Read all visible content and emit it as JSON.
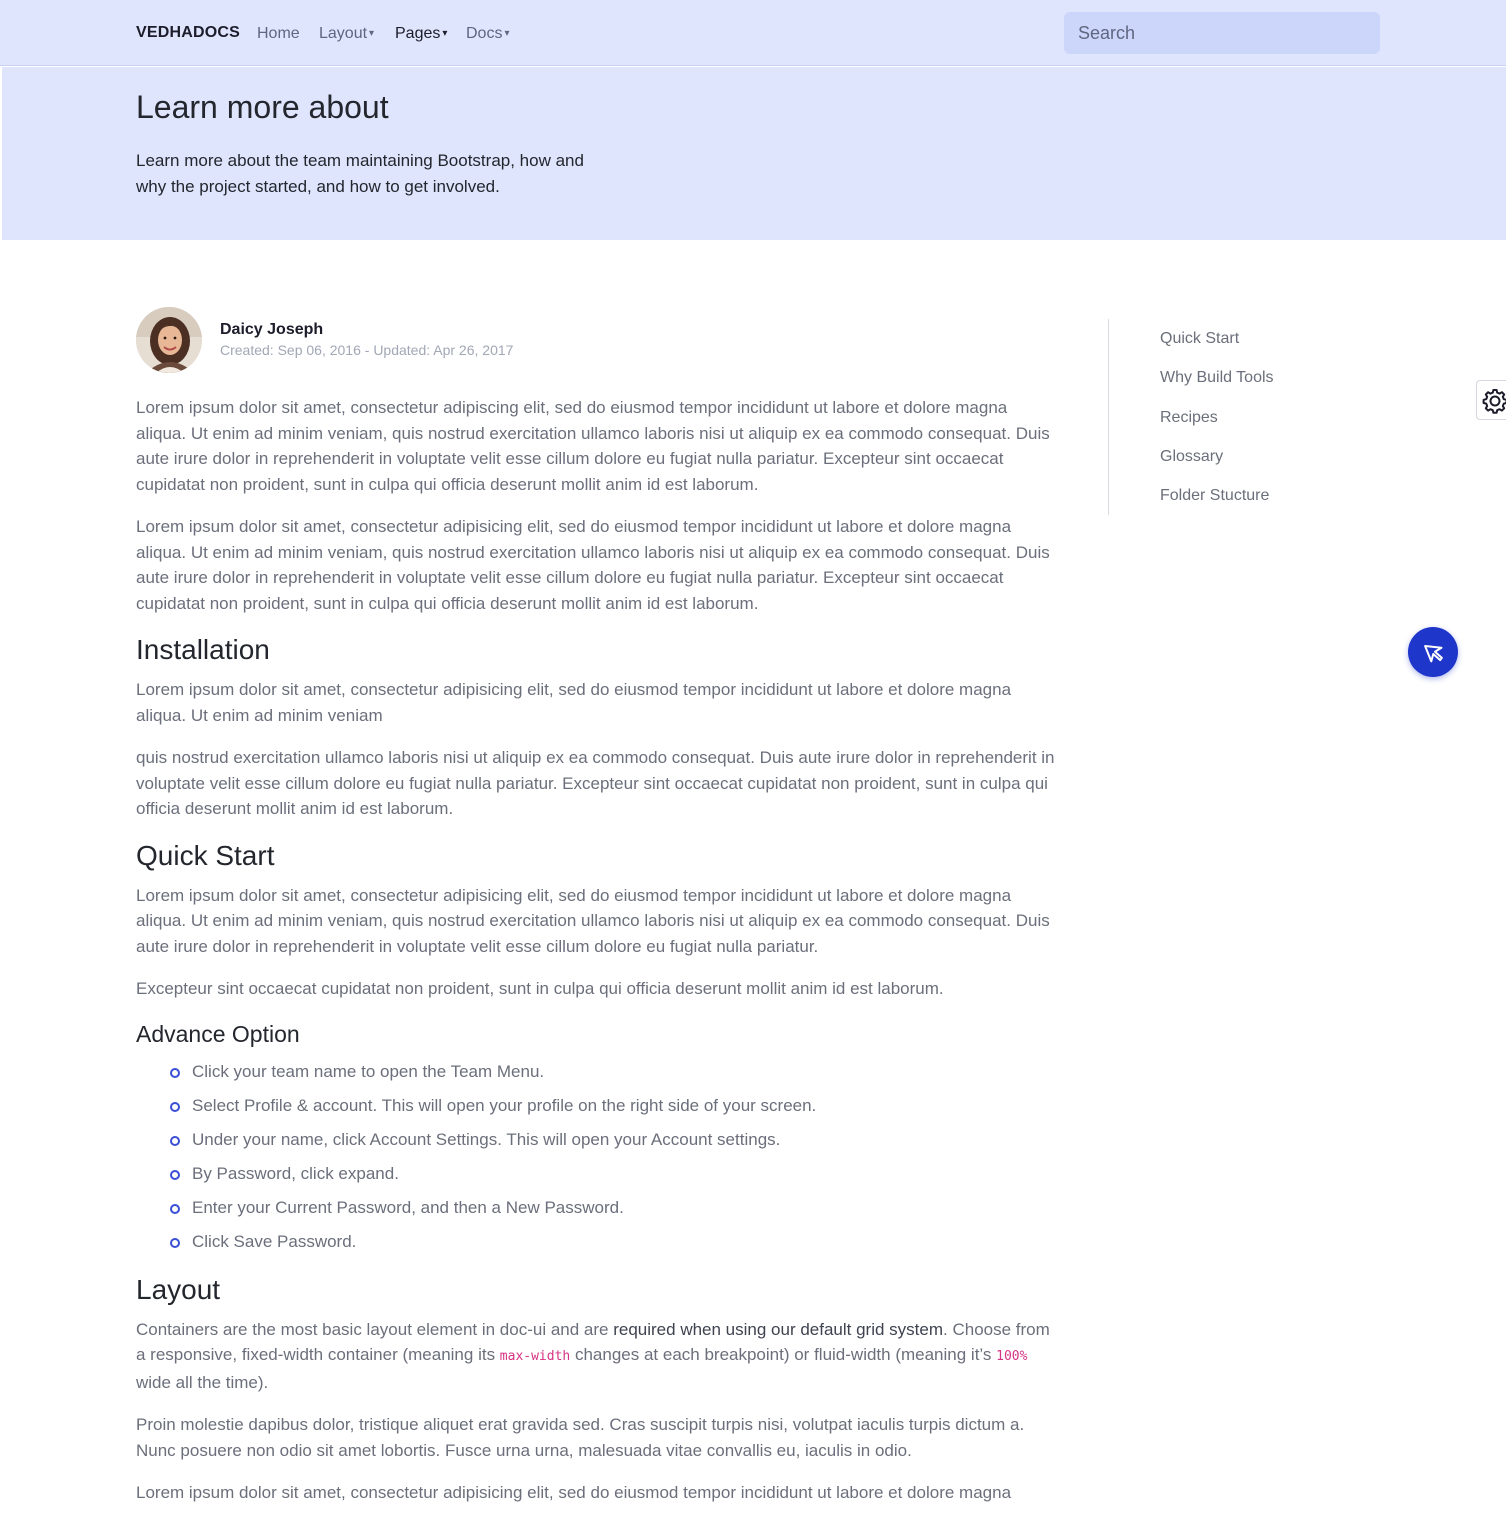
{
  "navbar": {
    "brand": "VEDHADOCS",
    "items": [
      {
        "label": "Home",
        "caret": ""
      },
      {
        "label": "Layout",
        "caret": "▾"
      },
      {
        "label": "Pages",
        "caret": "▾"
      },
      {
        "label": "Docs",
        "caret": "▾"
      }
    ],
    "search_placeholder": "Search"
  },
  "hero": {
    "title": "Learn more about",
    "text": "Learn more about the team maintaining Bootstrap, how and why the project started, and how to get involved."
  },
  "author": {
    "name": "Daicy Joseph",
    "meta": "Created: Sep 06, 2016 - Updated: Apr 26, 2017"
  },
  "content": {
    "intro_1": "Lorem ipsum dolor sit amet, consectetur adipiscing elit, sed do eiusmod tempor incididunt ut labore et dolore magna aliqua. Ut enim ad minim veniam, quis nostrud exercitation ullamco laboris nisi ut aliquip ex ea commodo consequat. Duis aute irure dolor in reprehenderit in voluptate velit esse cillum dolore eu fugiat nulla pariatur. Excepteur sint occaecat cupidatat non proident, sunt in culpa qui officia deserunt mollit anim id est laborum.",
    "intro_2": "Lorem ipsum dolor sit amet, consectetur adipisicing elit, sed do eiusmod tempor incididunt ut labore et dolore magna aliqua. Ut enim ad minim veniam, quis nostrud exercitation ullamco laboris nisi ut aliquip ex ea commodo consequat. Duis aute irure dolor in reprehenderit in voluptate velit esse cillum dolore eu fugiat nulla pariatur. Excepteur sint occaecat cupidatat non proident, sunt in culpa qui officia deserunt mollit anim id est laborum.",
    "installation": {
      "heading": "Installation",
      "p1": "Lorem ipsum dolor sit amet, consectetur adipisicing elit, sed do eiusmod tempor incididunt ut labore et dolore magna aliqua. Ut enim ad minim veniam",
      "p2": "quis nostrud exercitation ullamco laboris nisi ut aliquip ex ea commodo consequat. Duis aute irure dolor in reprehenderit in voluptate velit esse cillum dolore eu fugiat nulla pariatur. Excepteur sint occaecat cupidatat non proident, sunt in culpa qui officia deserunt mollit anim id est laborum."
    },
    "quick_start": {
      "heading": "Quick Start",
      "p1": "Lorem ipsum dolor sit amet, consectetur adipisicing elit, sed do eiusmod tempor incididunt ut labore et dolore magna aliqua. Ut enim ad minim veniam, quis nostrud exercitation ullamco laboris nisi ut aliquip ex ea commodo consequat. Duis aute irure dolor in reprehenderit in voluptate velit esse cillum dolore eu fugiat nulla pariatur.",
      "p2": "Excepteur sint occaecat cupidatat non proident, sunt in culpa qui officia deserunt mollit anim id est laborum."
    },
    "advance_option": {
      "heading": "Advance Option",
      "items": [
        "Click your team name to open the Team Menu.",
        "Select Profile & account. This will open your profile on the right side of your screen.",
        "Under your name, click Account Settings. This will open your Account settings.",
        "By Password, click expand.",
        "Enter your Current Password, and then a New Password.",
        "Click Save Password."
      ]
    },
    "layout": {
      "heading": "Layout",
      "p1_a": "Containers are the most basic layout element in doc-ui and are ",
      "p1_strong": "required when using our default grid system",
      "p1_b": ". Choose from a responsive, fixed-width container (meaning its ",
      "p1_code1": "max-width",
      "p1_c": " changes at each breakpoint) or fluid-width (meaning it’s ",
      "p1_code2": "100%",
      "p1_d": " wide all the time).",
      "p2": "Proin molestie dapibus dolor, tristique aliquet erat gravida sed. Cras suscipit turpis nisi, volutpat iaculis turpis dictum a. Nunc posuere non odio sit amet lobortis. Fusce urna urna, malesuada vitae convallis eu, iaculis in odio.",
      "p3": "Lorem ipsum dolor sit amet, consectetur adipisicing elit, sed do eiusmod tempor incididunt ut labore et dolore magna"
    }
  },
  "toc": {
    "items": [
      "Quick Start",
      "Why Build Tools",
      "Recipes",
      "Glossary",
      "Folder Stucture"
    ]
  },
  "colors": {
    "navbar_bg": "#dfe5fd",
    "hero_bg": "#dee5fd",
    "search_bg": "#ccd6fb",
    "accent": "#1e36c9",
    "code": "#d63384"
  },
  "icons": {
    "settings": "gear-icon",
    "fab": "cursor-arrow-icon"
  }
}
